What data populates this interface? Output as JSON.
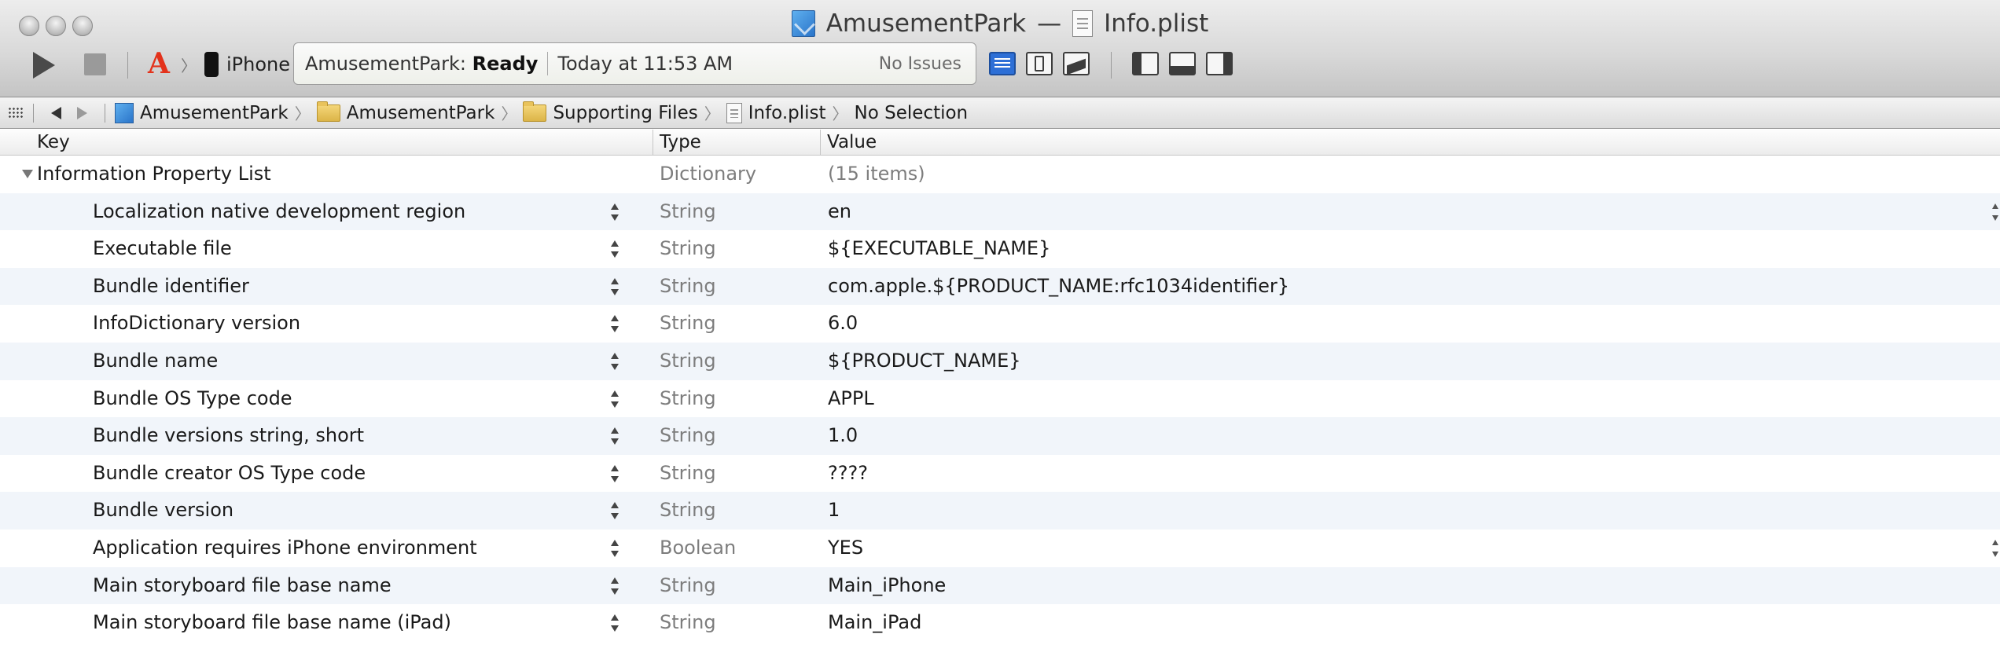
{
  "window": {
    "title_project": "AmusementPark",
    "title_separator": "—",
    "title_file": "Info.plist"
  },
  "toolbar": {
    "scheme_device": "iPhone",
    "status_prefix": "AmusementPark: ",
    "status_state": "Ready",
    "status_time": "Today at 11:53 AM",
    "status_issues": "No Issues"
  },
  "jumpbar": {
    "crumbs": [
      "AmusementPark",
      "AmusementPark",
      "Supporting Files",
      "Info.plist",
      "No Selection"
    ]
  },
  "editor": {
    "columns": {
      "key": "Key",
      "type": "Type",
      "value": "Value"
    },
    "root": {
      "key": "Information Property List",
      "type": "Dictionary",
      "value": "(15 items)"
    },
    "rows": [
      {
        "key": "Localization native development region",
        "type": "String",
        "value": "en"
      },
      {
        "key": "Executable file",
        "type": "String",
        "value": "${EXECUTABLE_NAME}"
      },
      {
        "key": "Bundle identifier",
        "type": "String",
        "value": "com.apple.${PRODUCT_NAME:rfc1034identifier}"
      },
      {
        "key": "InfoDictionary version",
        "type": "String",
        "value": "6.0"
      },
      {
        "key": "Bundle name",
        "type": "String",
        "value": "${PRODUCT_NAME}"
      },
      {
        "key": "Bundle OS Type code",
        "type": "String",
        "value": "APPL"
      },
      {
        "key": "Bundle versions string, short",
        "type": "String",
        "value": "1.0"
      },
      {
        "key": "Bundle creator OS Type code",
        "type": "String",
        "value": "????"
      },
      {
        "key": "Bundle version",
        "type": "String",
        "value": "1"
      },
      {
        "key": "Application requires iPhone environment",
        "type": "Boolean",
        "value": "YES"
      },
      {
        "key": "Main storyboard file base name",
        "type": "String",
        "value": "Main_iPhone"
      },
      {
        "key": "Main storyboard file base name (iPad)",
        "type": "String",
        "value": "Main_iPad"
      }
    ]
  }
}
